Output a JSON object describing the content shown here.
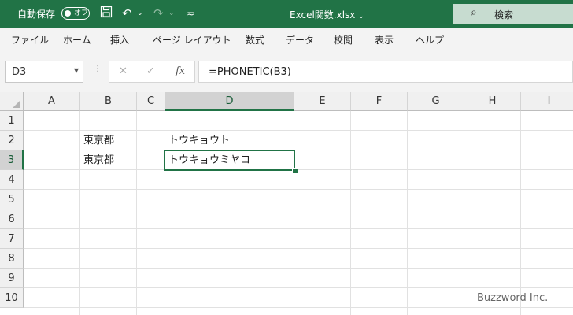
{
  "titlebar": {
    "autosave_label": "自動保存",
    "autosave_state": "オフ",
    "filename": "Excel関数.xlsx",
    "filename_dropdown": "⌄",
    "search_placeholder": "検索",
    "icons": [
      "save-icon",
      "undo-icon",
      "redo-icon",
      "customize-icon",
      "search-icon"
    ]
  },
  "ribbon": {
    "tabs": [
      "ファイル",
      "ホーム",
      "挿入",
      "ページ レイアウト",
      "数式",
      "データ",
      "校閲",
      "表示",
      "ヘルプ"
    ]
  },
  "formula_bar": {
    "name_box": "D3",
    "formula": "=PHONETIC(B3)",
    "fx_label": "fx"
  },
  "sheet": {
    "columns": [
      "A",
      "B",
      "C",
      "D",
      "E",
      "F",
      "G",
      "H",
      "I"
    ],
    "rows": [
      "1",
      "2",
      "3",
      "4",
      "5",
      "6",
      "7",
      "8",
      "9",
      "10"
    ],
    "selected_column": "D",
    "selected_row": "3",
    "cells": {
      "B2": "東京都",
      "D2": "トウキョウト",
      "B3": "東京都",
      "D3": "トウキョウミヤコ"
    }
  },
  "watermark": "Buzzword Inc."
}
